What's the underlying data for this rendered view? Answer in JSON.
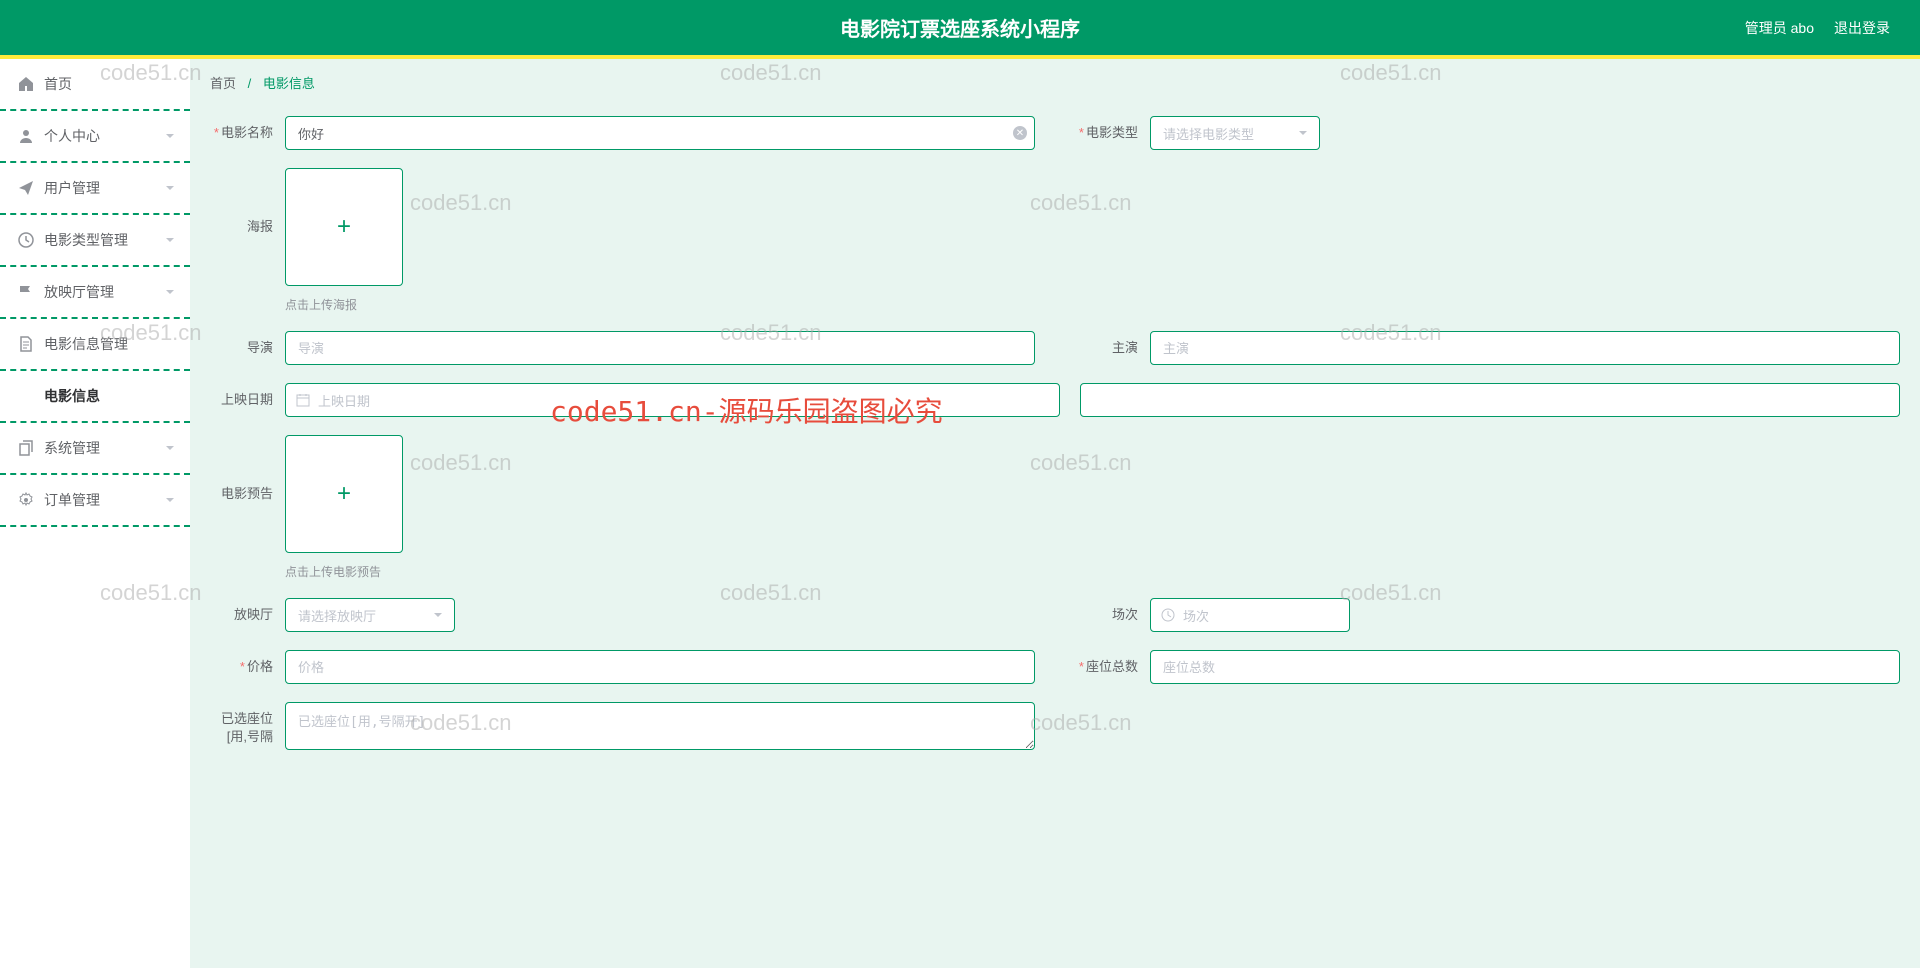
{
  "header": {
    "title": "电影院订票选座系统小程序",
    "admin_label": "管理员 abo",
    "logout_label": "退出登录"
  },
  "sidebar": {
    "items": [
      {
        "icon": "home",
        "label": "首页",
        "expandable": false
      },
      {
        "icon": "user",
        "label": "个人中心",
        "expandable": true
      },
      {
        "icon": "send",
        "label": "用户管理",
        "expandable": true
      },
      {
        "icon": "clock",
        "label": "电影类型管理",
        "expandable": true
      },
      {
        "icon": "flag",
        "label": "放映厅管理",
        "expandable": true
      },
      {
        "icon": "doc",
        "label": "电影信息管理",
        "expandable": true,
        "sub": "电影信息"
      },
      {
        "icon": "copy",
        "label": "系统管理",
        "expandable": true
      },
      {
        "icon": "gear",
        "label": "订单管理",
        "expandable": true
      }
    ]
  },
  "breadcrumb": {
    "home": "首页",
    "current": "电影信息"
  },
  "form": {
    "movie_name_label": "电影名称",
    "movie_name_value": "你好",
    "movie_type_label": "电影类型",
    "movie_type_placeholder": "请选择电影类型",
    "poster_label": "海报",
    "poster_hint": "点击上传海报",
    "director_label": "导演",
    "director_placeholder": "导演",
    "actor_label": "主演",
    "actor_placeholder": "主演",
    "release_date_label": "上映日期",
    "release_date_placeholder": "上映日期",
    "trailer_label": "电影预告",
    "trailer_hint": "点击上传电影预告",
    "hall_label": "放映厅",
    "hall_placeholder": "请选择放映厅",
    "session_label": "场次",
    "session_placeholder": "场次",
    "price_label": "价格",
    "price_placeholder": "价格",
    "seats_total_label": "座位总数",
    "seats_total_placeholder": "座位总数",
    "seats_selected_label": "已选座位[用,号隔",
    "seats_selected_placeholder": "已选座位[用,号隔开]"
  },
  "watermarks": {
    "text": "code51.cn",
    "red": "code51.cn-源码乐园盗图必究"
  }
}
